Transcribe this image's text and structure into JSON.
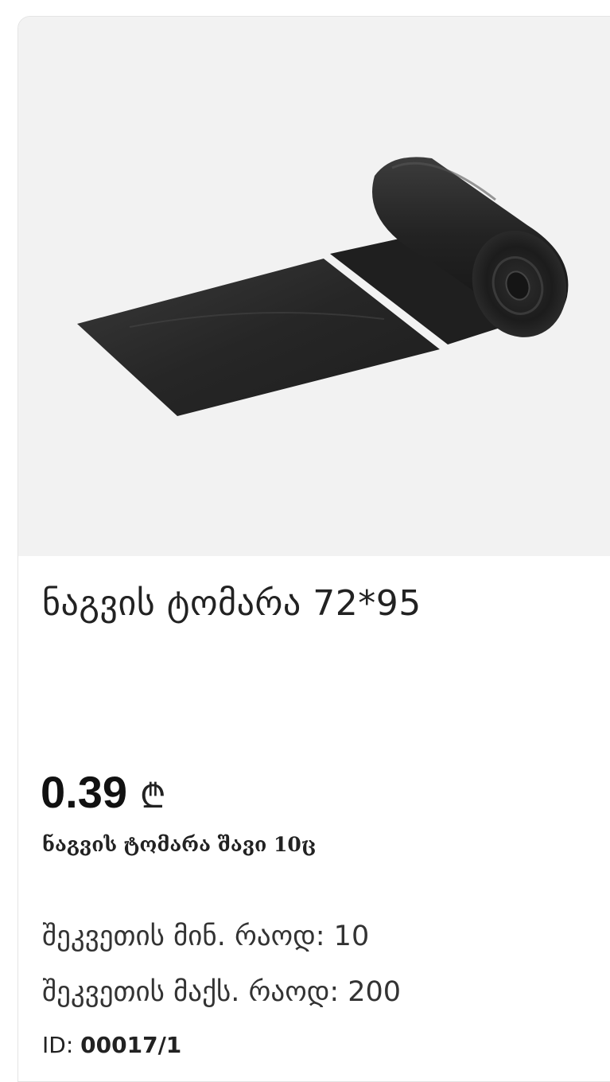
{
  "product": {
    "image_alt": "black garbage bag roll",
    "title": "ნაგვის ტომარა 72*95",
    "price": "0.39",
    "currency": "₾",
    "subtitle": "ნაგვის ტომარა შავი 10ც",
    "min_order": {
      "label": "შეკვეთის მინ. რაოდ:",
      "value": "10"
    },
    "max_order": {
      "label": "შეკვეთის მაქს. რაოდ:",
      "value": "200"
    },
    "id": {
      "label": "ID:",
      "value": "00017/1"
    }
  },
  "colors": {
    "image_background": "#f2f2f2",
    "bag": "#2a2a2a"
  }
}
